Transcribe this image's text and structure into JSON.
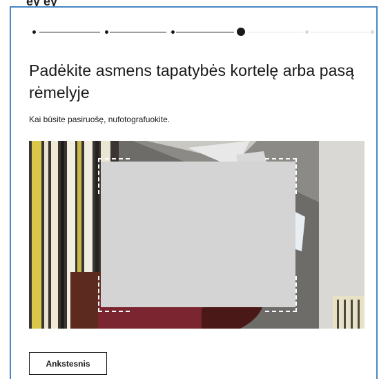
{
  "header": {
    "cut_text": "ey ey"
  },
  "progress": {
    "total_steps": 6,
    "current_step": 4
  },
  "page": {
    "title": "Padėkite asmens tapatybės kortelę arba pasą rėmelyje",
    "subtitle": "Kai būsite pasiruošę, nufotografuokite."
  },
  "buttons": {
    "back_label": "Ankstesnis"
  },
  "colors": {
    "frame_border": "#4a86c5",
    "text": "#1a1a1a",
    "card_placeholder": "#d4d4d4",
    "inactive_step": "#d9d9d9"
  }
}
